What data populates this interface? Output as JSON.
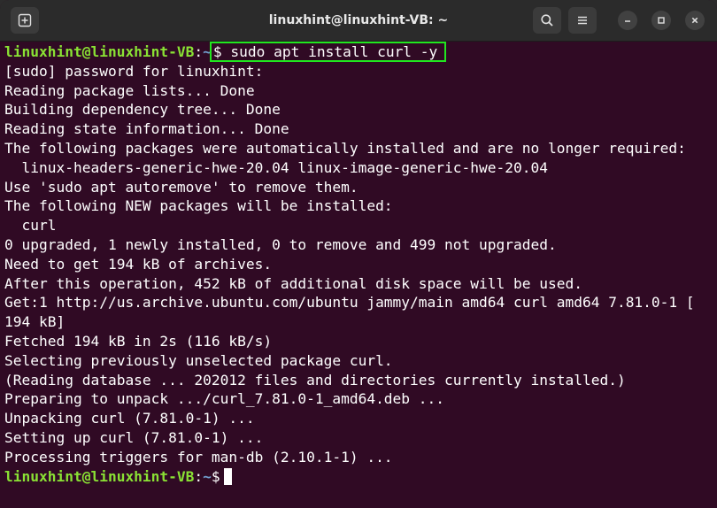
{
  "window": {
    "title": "linuxhint@linuxhint-VB: ~"
  },
  "icons": {
    "new_tab": "new-tab-icon",
    "search": "search-icon",
    "menu": "hamburger-menu-icon",
    "minimize": "minimize-icon",
    "maximize": "maximize-icon",
    "close": "close-icon"
  },
  "colors": {
    "background": "#300a24",
    "prompt_user": "#8ae234",
    "prompt_path": "#729fcf",
    "text": "#ffffff",
    "highlight_box": "#21e61f"
  },
  "terminal": {
    "prompt1": {
      "user": "linuxhint@linuxhint-VB",
      "sep": ":",
      "path": "~",
      "command": "$ sudo apt install curl -y"
    },
    "output": [
      "[sudo] password for linuxhint:",
      "Reading package lists... Done",
      "Building dependency tree... Done",
      "Reading state information... Done",
      "The following packages were automatically installed and are no longer required:",
      "  linux-headers-generic-hwe-20.04 linux-image-generic-hwe-20.04",
      "Use 'sudo apt autoremove' to remove them.",
      "The following NEW packages will be installed:",
      "  curl",
      "0 upgraded, 1 newly installed, 0 to remove and 499 not upgraded.",
      "Need to get 194 kB of archives.",
      "After this operation, 452 kB of additional disk space will be used.",
      "Get:1 http://us.archive.ubuntu.com/ubuntu jammy/main amd64 curl amd64 7.81.0-1 [",
      "194 kB]",
      "Fetched 194 kB in 2s (116 kB/s)",
      "Selecting previously unselected package curl.",
      "(Reading database ... 202012 files and directories currently installed.)",
      "Preparing to unpack .../curl_7.81.0-1_amd64.deb ...",
      "Unpacking curl (7.81.0-1) ...",
      "Setting up curl (7.81.0-1) ...",
      "Processing triggers for man-db (2.10.1-1) ..."
    ],
    "prompt2": {
      "user": "linuxhint@linuxhint-VB",
      "sep": ":",
      "path": "~",
      "symbol": "$"
    }
  }
}
